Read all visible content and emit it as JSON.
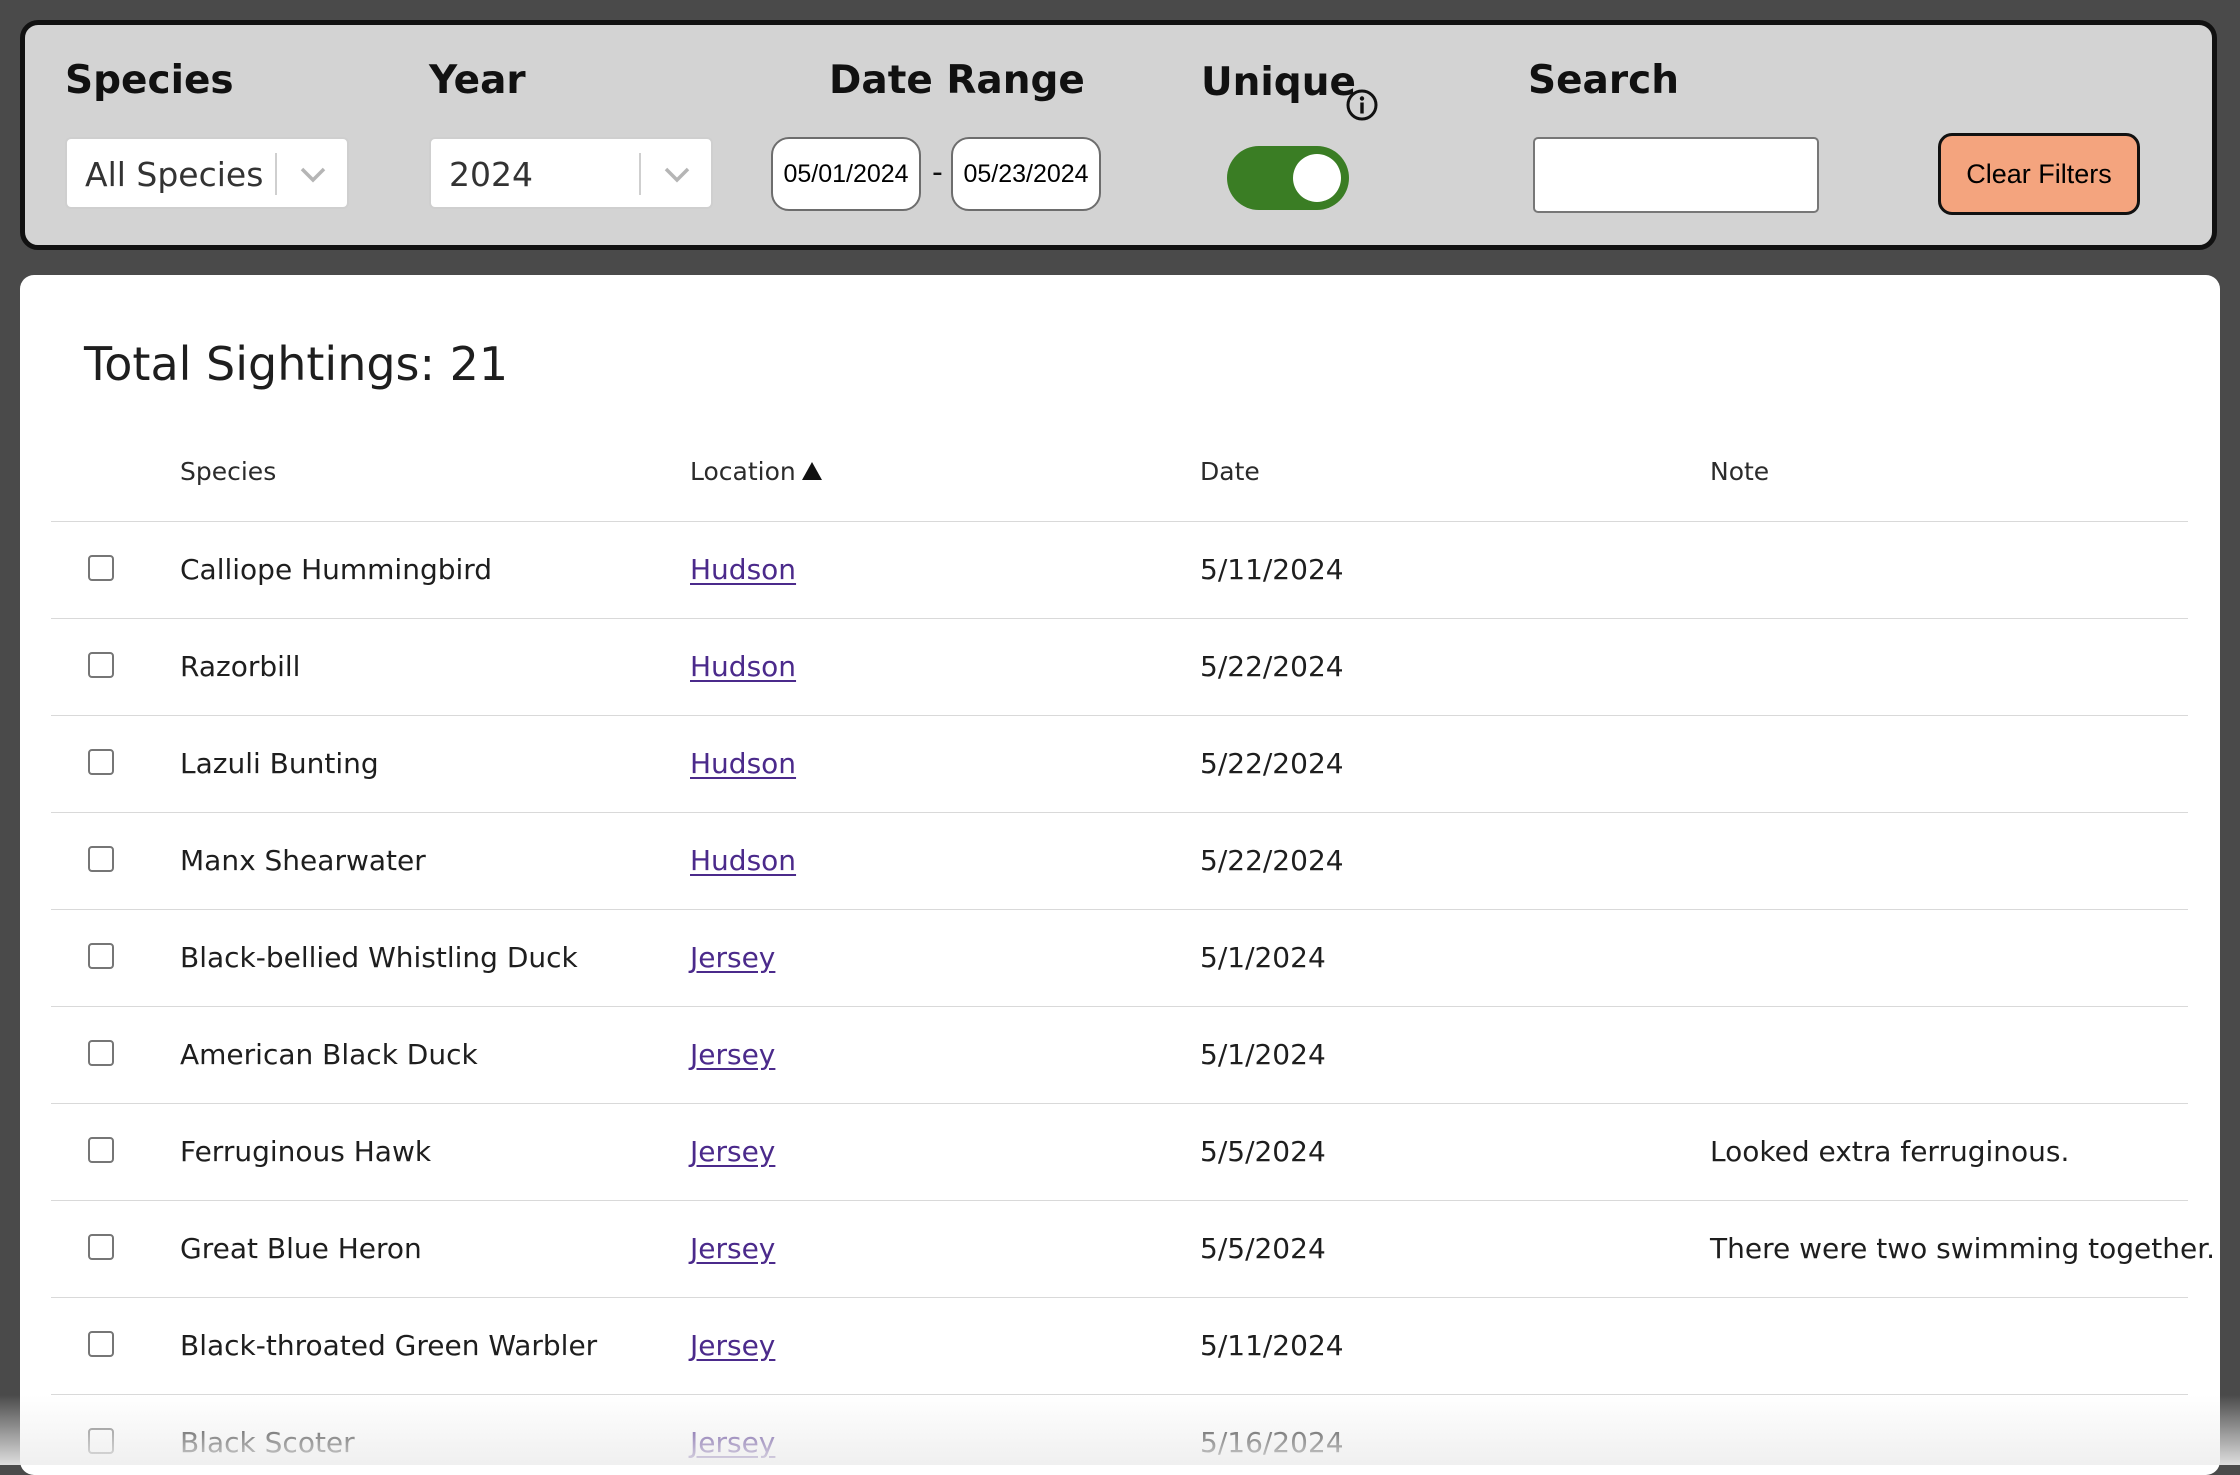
{
  "filters": {
    "species": {
      "label": "Species",
      "selected": "All Species"
    },
    "year": {
      "label": "Year",
      "selected": "2024"
    },
    "date_range": {
      "label": "Date Range",
      "start": "05/01/2024",
      "separator": "-",
      "end": "05/23/2024"
    },
    "unique": {
      "label": "Unique",
      "enabled": true,
      "toggle_color": "#3a7d24"
    },
    "search": {
      "label": "Search",
      "value": "",
      "placeholder": ""
    },
    "clear_button_label": "Clear Filters",
    "clear_button_color": "#f4a47e"
  },
  "summary": {
    "total_label": "Total Sightings: 21"
  },
  "table": {
    "columns": [
      "Species",
      "Location",
      "Date",
      "Note"
    ],
    "sorted_column": "Location",
    "sort_direction": "ascending",
    "rows": [
      {
        "species": "Calliope Hummingbird",
        "location": "Hudson",
        "date": "5/11/2024",
        "note": ""
      },
      {
        "species": "Razorbill",
        "location": "Hudson",
        "date": "5/22/2024",
        "note": ""
      },
      {
        "species": "Lazuli Bunting",
        "location": "Hudson",
        "date": "5/22/2024",
        "note": ""
      },
      {
        "species": "Manx Shearwater",
        "location": "Hudson",
        "date": "5/22/2024",
        "note": ""
      },
      {
        "species": "Black-bellied Whistling Duck",
        "location": "Jersey",
        "date": "5/1/2024",
        "note": ""
      },
      {
        "species": "American Black Duck",
        "location": "Jersey",
        "date": "5/1/2024",
        "note": ""
      },
      {
        "species": "Ferruginous Hawk",
        "location": "Jersey",
        "date": "5/5/2024",
        "note": "Looked extra ferruginous."
      },
      {
        "species": "Great Blue Heron",
        "location": "Jersey",
        "date": "5/5/2024",
        "note": "There were two swimming together."
      },
      {
        "species": "Black-throated Green Warbler",
        "location": "Jersey",
        "date": "5/11/2024",
        "note": ""
      },
      {
        "species": "Black Scoter",
        "location": "Jersey",
        "date": "5/16/2024",
        "note": ""
      }
    ]
  },
  "icons": {
    "chevron": "chevron-down-icon",
    "info": "info-icon",
    "sort": "sort-ascending-icon"
  },
  "colors": {
    "link": "#4b2a8b",
    "filter_bar_background": "#d3d3d3",
    "page_background": "#4a4a4a"
  }
}
